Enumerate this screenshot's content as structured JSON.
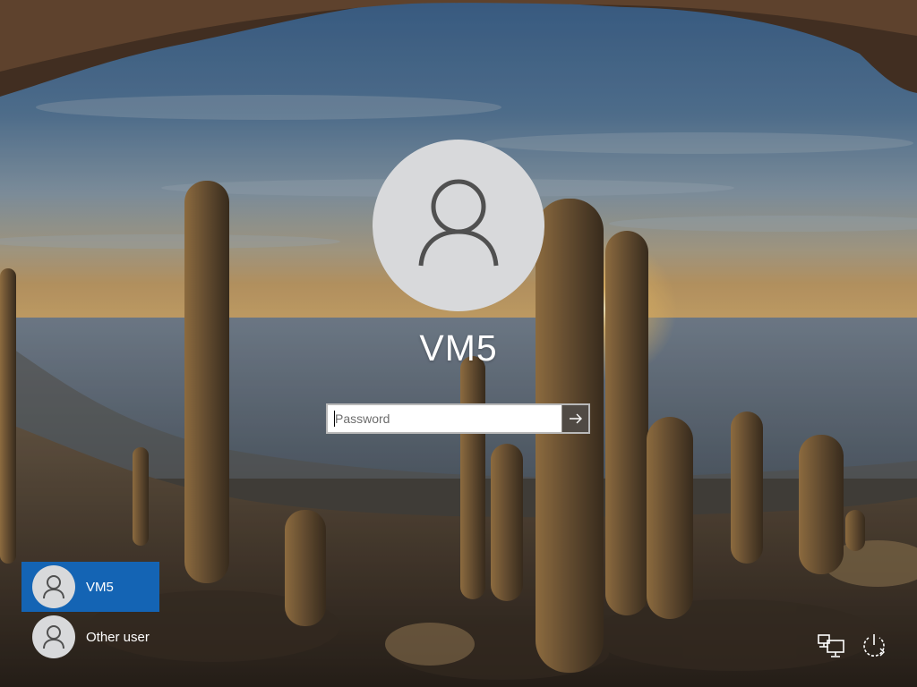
{
  "lock_screen": {
    "current_user": "VM5",
    "password": {
      "placeholder": "Password",
      "value": ""
    },
    "submit_icon": "arrow-right-icon",
    "avatar_icon": "user-icon"
  },
  "user_list": [
    {
      "label": "VM5",
      "selected": true,
      "icon": "user-icon"
    },
    {
      "label": "Other user",
      "selected": false,
      "icon": "user-icon"
    }
  ],
  "corner_icons": [
    "network-icon",
    "power-icon"
  ],
  "colors": {
    "selected_tile": "#1464b4",
    "avatar_bg": "#d8d9db",
    "submit_bg": "#504a44"
  }
}
